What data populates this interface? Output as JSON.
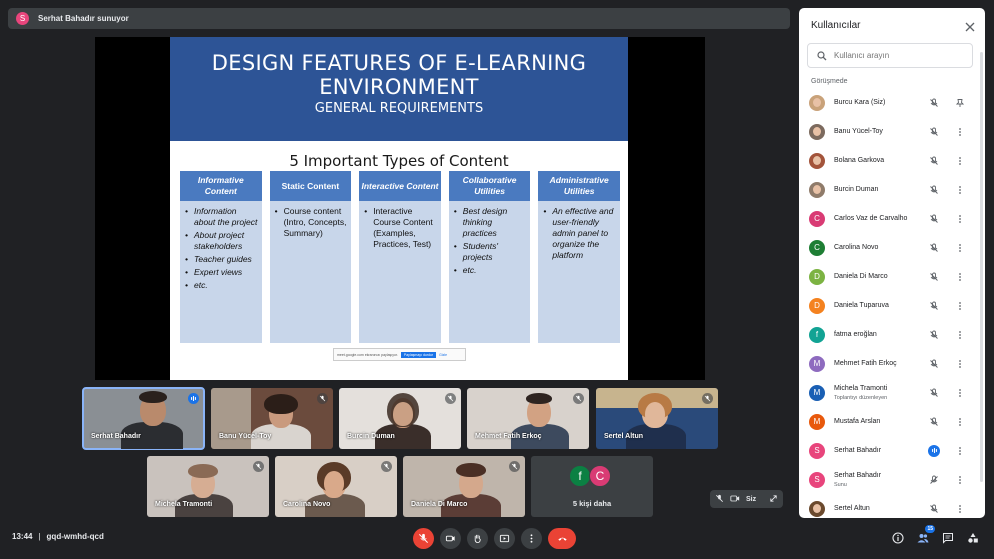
{
  "topbar": {
    "avatar_letter": "S",
    "presenter_text": "Serhat Bahadır sunuyor"
  },
  "slide": {
    "title": "DESIGN FEATURES OF E-LEARNING ENVIRONMENT",
    "subtitle": "GENERAL REQUIREMENTS",
    "heading": "5 Important Types of Content",
    "columns": [
      {
        "title": "Informative Content",
        "items": [
          "Information about the project",
          "About project stakeholders",
          "Teacher guides",
          "Expert views",
          "etc."
        ]
      },
      {
        "title": "Static Content",
        "items": [
          "Course content (Intro, Concepts, Summary)"
        ]
      },
      {
        "title": "Interactive Content",
        "items": [
          "Interactive Course Content (Examples, Practices, Test)"
        ]
      },
      {
        "title": "Collaborative Utilities",
        "items": [
          "Best design thinking practices",
          "Students' projects",
          "etc."
        ]
      },
      {
        "title": "Administrative Utilities",
        "items": [
          "An effective and user-friendly admin panel to organize the platform"
        ]
      }
    ],
    "share_text": "meet.google.com ekranınızı paylaşıyor.",
    "share_stop": "Paylaşmayı durdur",
    "share_hide": "Gizle"
  },
  "tiles": [
    {
      "name": "Serhat Bahadır",
      "speaking": true
    },
    {
      "name": "Banu Yücel-Toy"
    },
    {
      "name": "Burcin Duman"
    },
    {
      "name": "Mehmet Fatih Erkoç"
    },
    {
      "name": "Sertel Altun"
    },
    {
      "name": "Michela Tramonti"
    },
    {
      "name": "Carolina Novo"
    },
    {
      "name": "Daniela Di Marco"
    }
  ],
  "more_tile": {
    "label": "5 kişi daha",
    "avatars": [
      {
        "letter": "f",
        "color": "#0b8043"
      },
      {
        "letter": "C",
        "color": "#d93b74"
      }
    ]
  },
  "self_pill": {
    "label": "Siz"
  },
  "bottom": {
    "time": "13:44",
    "separator": "|",
    "meeting_code": "gqd-wmhd-qcd",
    "people_count": "15"
  },
  "panel": {
    "title": "Kullanıcılar",
    "search_placeholder": "Kullanıcı arayın",
    "section_label": "Görüşmede",
    "people": [
      {
        "name": "Burcu Kara (Siz)",
        "avatar": "photo",
        "color": "#c9a27a",
        "letter": "",
        "mic": "muted",
        "action": "pin"
      },
      {
        "name": "Banu Yücel-Toy",
        "avatar": "photo",
        "color": "#7c6a5e",
        "letter": "",
        "mic": "muted",
        "action": "more"
      },
      {
        "name": "Bolana Garkova",
        "avatar": "photo",
        "color": "#a3543b",
        "letter": "",
        "mic": "muted",
        "action": "more"
      },
      {
        "name": "Burcin Duman",
        "avatar": "photo",
        "color": "#8f7b6a",
        "letter": "",
        "mic": "muted",
        "action": "more"
      },
      {
        "name": "Carlos Vaz de Carvalho",
        "avatar": "letter",
        "color": "#d93b74",
        "letter": "C",
        "mic": "muted",
        "action": "more"
      },
      {
        "name": "Carolina Novo",
        "avatar": "letter",
        "color": "#1e7e34",
        "letter": "C",
        "mic": "muted",
        "action": "more"
      },
      {
        "name": "Daniela Di Marco",
        "avatar": "letter",
        "color": "#7cb342",
        "letter": "D",
        "mic": "muted",
        "action": "more"
      },
      {
        "name": "Daniela Tuparuva",
        "avatar": "letter",
        "color": "#f4821f",
        "letter": "D",
        "mic": "muted",
        "action": "more"
      },
      {
        "name": "fatma eroğlan",
        "avatar": "letter",
        "color": "#12a394",
        "letter": "f",
        "mic": "muted",
        "action": "more"
      },
      {
        "name": "Mehmet Fatih Erkoç",
        "avatar": "letter",
        "color": "#8e6bbf",
        "letter": "M",
        "mic": "muted",
        "action": "more"
      },
      {
        "name": "Michela Tramonti",
        "sub": "Toplantıyı düzenleyen",
        "avatar": "letter",
        "color": "#1a5fb4",
        "letter": "M",
        "mic": "muted",
        "action": "more"
      },
      {
        "name": "Mustafa Arslan",
        "avatar": "letter",
        "color": "#e8590c",
        "letter": "M",
        "mic": "muted",
        "action": "more"
      },
      {
        "name": "Serhat Bahadır",
        "avatar": "letter",
        "color": "#e8457c",
        "letter": "S",
        "mic": "active",
        "action": "more"
      },
      {
        "name": "Serhat Bahadır",
        "sub": "Sunu",
        "avatar": "letter",
        "color": "#e8457c",
        "letter": "S",
        "mic": "presenting",
        "action": "more"
      },
      {
        "name": "Sertel Altun",
        "avatar": "photo",
        "color": "#6b4a2e",
        "letter": "",
        "mic": "muted",
        "action": "more"
      }
    ]
  }
}
